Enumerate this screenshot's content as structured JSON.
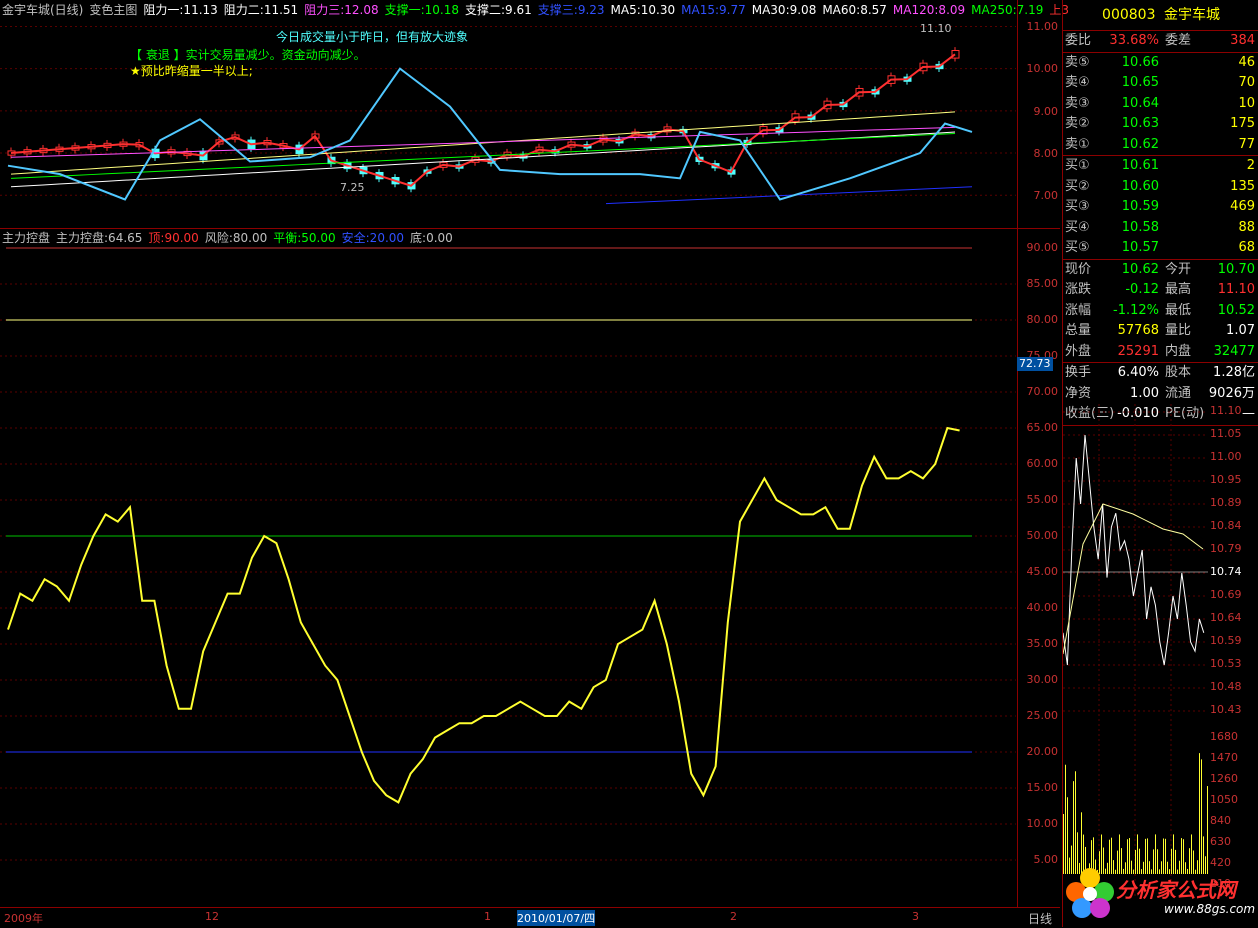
{
  "top_indicators": [
    {
      "text": "金宇车城(日线)",
      "color": "#c0c0c0"
    },
    {
      "text": "变色主图",
      "color": "#c0c0c0"
    },
    {
      "text": "阻力一:11.13",
      "color": "#ffffff"
    },
    {
      "text": "阻力二:11.51",
      "color": "#ffffff"
    },
    {
      "text": "阻力三:12.08",
      "color": "#ff50ff"
    },
    {
      "text": "支撑一:10.18",
      "color": "#00ff00"
    },
    {
      "text": "支撑二:9.61",
      "color": "#ffffff"
    },
    {
      "text": "支撑三:9.23",
      "color": "#3050ff"
    },
    {
      "text": "MA5:10.30",
      "color": "#ffffff"
    },
    {
      "text": "MA15:9.77",
      "color": "#3050ff"
    },
    {
      "text": "MA30:9.08",
      "color": "#ffffff"
    },
    {
      "text": "MA60:8.57",
      "color": "#ffffff"
    },
    {
      "text": "MA120:8.09",
      "color": "#ff50ff"
    },
    {
      "text": "MA250:7.19",
      "color": "#00ff00"
    },
    {
      "text": "上3",
      "color": "#ff3030"
    }
  ],
  "annotations": {
    "line1": "今日成交量小于昨日，但有放大迹象",
    "line2": "【 衰退 】实计交易量减少。资金动向减少。",
    "line3": "★预比昨缩量一半以上;",
    "high_label": "11.10",
    "low_label": "7.25"
  },
  "main_yaxis": [
    "11.00",
    "10.00",
    "9.00",
    "8.00",
    "7.00"
  ],
  "sub_indicators": [
    {
      "text": "主力控盘",
      "color": "#c0c0c0"
    },
    {
      "text": "主力控盘:64.65",
      "color": "#c0c0c0"
    },
    {
      "text": "顶:90.00",
      "color": "#ff3030"
    },
    {
      "text": "风险:80.00",
      "color": "#c0c0c0"
    },
    {
      "text": "平衡:50.00",
      "color": "#00ff00"
    },
    {
      "text": "安全:20.00",
      "color": "#3050ff"
    },
    {
      "text": "底:0.00",
      "color": "#c0c0c0"
    }
  ],
  "sub_yaxis": [
    "90.00",
    "85.00",
    "80.00",
    "75.00",
    "70.00",
    "65.00",
    "60.00",
    "55.00",
    "50.00",
    "45.00",
    "40.00",
    "35.00",
    "30.00",
    "25.00",
    "20.00",
    "15.00",
    "10.00",
    "5.00"
  ],
  "current_value_tag": "72.73",
  "date_axis": [
    {
      "text": "2009年"
    },
    {
      "text": "12"
    },
    {
      "text": "1"
    },
    {
      "text": "2010/01/07/四"
    },
    {
      "text": "2"
    },
    {
      "text": "3"
    }
  ],
  "period_label": "日线",
  "quote": {
    "code": "000803",
    "name": "金宇车城",
    "webi_label": "委比",
    "webi_value": "33.68%",
    "weicha_label": "委差",
    "weicha_value": "384",
    "asks": [
      {
        "label": "卖⑤",
        "price": "10.66",
        "vol": "46"
      },
      {
        "label": "卖④",
        "price": "10.65",
        "vol": "70"
      },
      {
        "label": "卖③",
        "price": "10.64",
        "vol": "10"
      },
      {
        "label": "卖②",
        "price": "10.63",
        "vol": "175"
      },
      {
        "label": "卖①",
        "price": "10.62",
        "vol": "77"
      }
    ],
    "bids": [
      {
        "label": "买①",
        "price": "10.61",
        "vol": "2"
      },
      {
        "label": "买②",
        "price": "10.60",
        "vol": "135"
      },
      {
        "label": "买③",
        "price": "10.59",
        "vol": "469"
      },
      {
        "label": "买④",
        "price": "10.58",
        "vol": "88"
      },
      {
        "label": "买⑤",
        "price": "10.57",
        "vol": "68"
      }
    ],
    "stats1": [
      {
        "l1": "现价",
        "v1": "10.62",
        "c1": "#00ff00",
        "l2": "今开",
        "v2": "10.70",
        "c2": "#00ff00"
      },
      {
        "l1": "涨跌",
        "v1": "-0.12",
        "c1": "#00ff00",
        "l2": "最高",
        "v2": "11.10",
        "c2": "#ff3030"
      },
      {
        "l1": "涨幅",
        "v1": "-1.12%",
        "c1": "#00ff00",
        "l2": "最低",
        "v2": "10.52",
        "c2": "#00ff00"
      },
      {
        "l1": "总量",
        "v1": "57768",
        "c1": "#ffff00",
        "l2": "量比",
        "v2": "1.07",
        "c2": "#ffffff"
      },
      {
        "l1": "外盘",
        "v1": "25291",
        "c1": "#ff3030",
        "l2": "内盘",
        "v2": "32477",
        "c2": "#00ff00"
      }
    ],
    "stats2": [
      {
        "l1": "换手",
        "v1": "6.40%",
        "c1": "#ffffff",
        "l2": "股本",
        "v2": "1.28亿",
        "c2": "#ffffff"
      },
      {
        "l1": "净资",
        "v1": "1.00",
        "c1": "#ffffff",
        "l2": "流通",
        "v2": "9026万",
        "c2": "#ffffff"
      },
      {
        "l1": "收益(三)",
        "v1": "-0.010",
        "c1": "#ffffff",
        "l2": "PE(动)",
        "v2": "—",
        "c2": "#ffffff"
      }
    ]
  },
  "mini_price_axis": [
    "11.10",
    "11.05",
    "11.00",
    "10.95",
    "10.89",
    "10.84",
    "10.79",
    "10.74",
    "10.69",
    "10.64",
    "10.59",
    "10.53",
    "10.48",
    "10.43"
  ],
  "mini_vol_axis": [
    "1680",
    "1470",
    "1260",
    "1050",
    "840",
    "630",
    "420",
    "210"
  ],
  "watermark": {
    "text": "分析家公式网",
    "url": "www.88gs.com"
  },
  "colors": {
    "up": "#ff3030",
    "down": "#50ffff",
    "yellow": "#ffff00",
    "axis": "#c83232"
  }
}
